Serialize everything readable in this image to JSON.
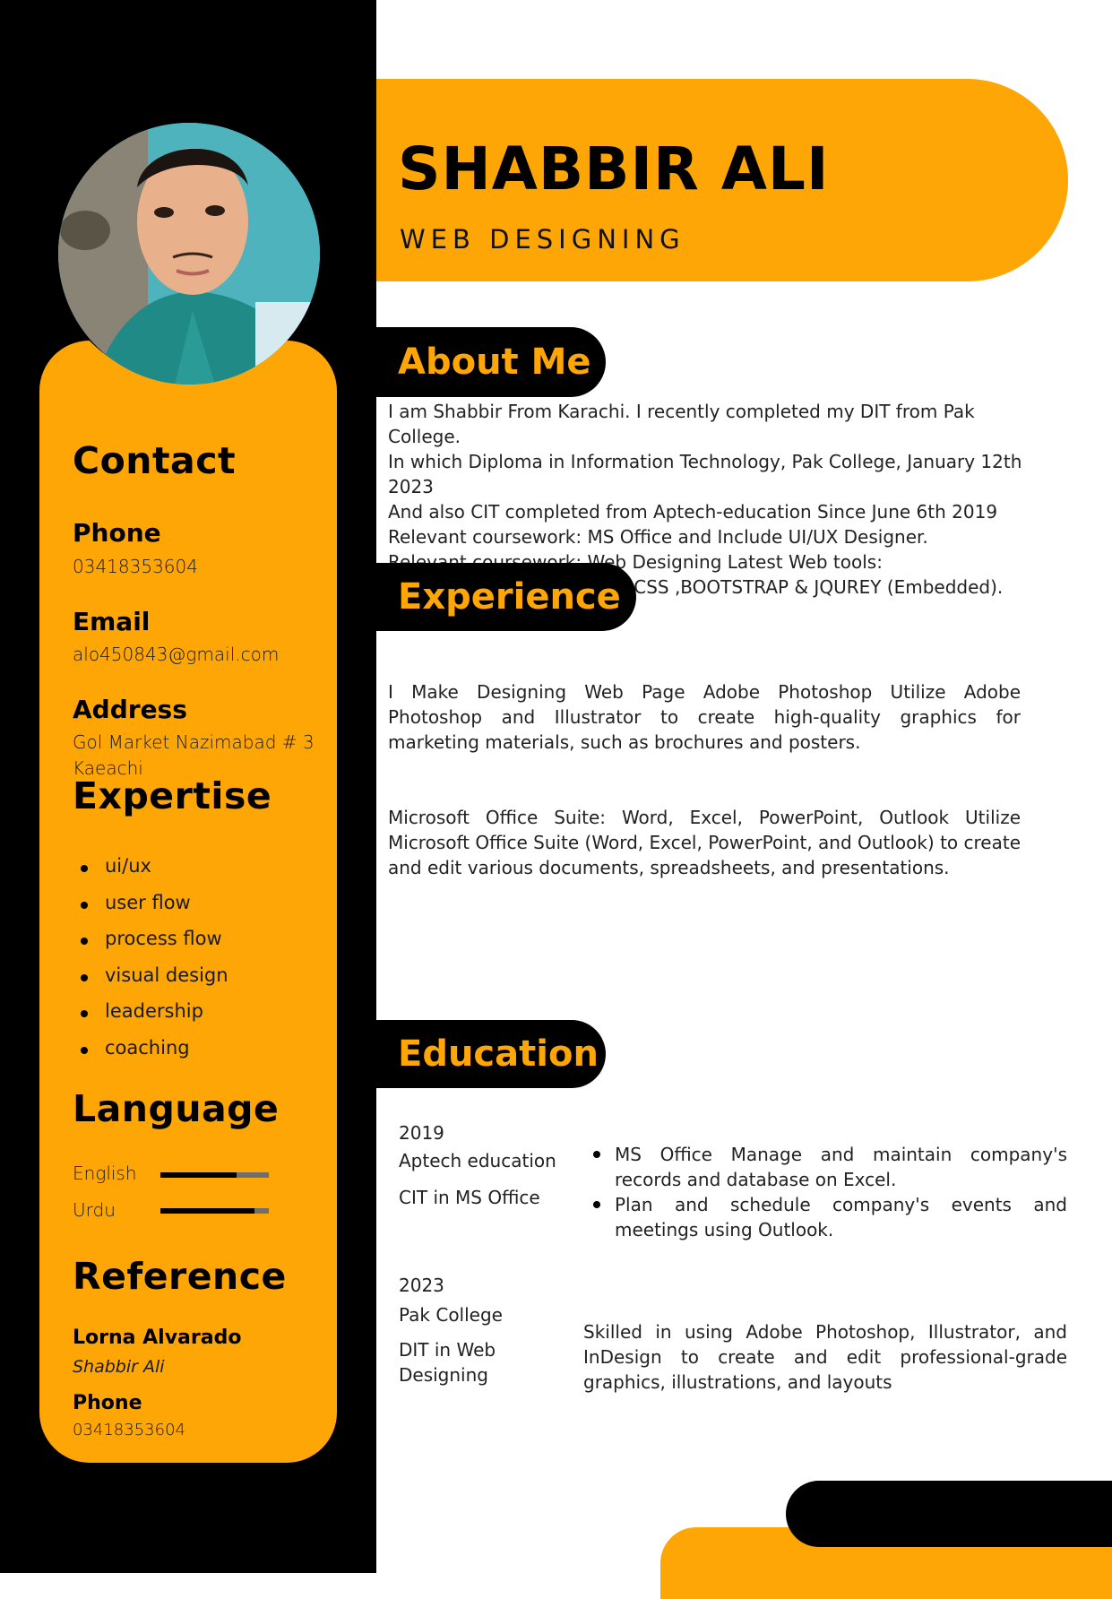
{
  "header": {
    "name": "SHABBIR ALI",
    "role": "WEB DESIGNING"
  },
  "sidebar": {
    "contact_heading": "Contact",
    "phone_label": "Phone",
    "phone_value": "03418353604",
    "email_label": "Email",
    "email_value": "alo450843@gmail.com",
    "address_label": "Address",
    "address_line1": "Gol Market Nazimabad # 3",
    "address_line2": "Kaeachi",
    "expertise_heading": "Expertise",
    "expertise": [
      "ui/ux",
      "user flow",
      "process flow",
      "visual design",
      "leadership",
      "coaching"
    ],
    "language_heading": "Language",
    "languages": [
      {
        "name": "English",
        "level": 0.7
      },
      {
        "name": "Urdu",
        "level": 0.87
      }
    ],
    "reference_heading": "Reference",
    "reference_name": "Lorna Alvarado",
    "reference_title": "Shabbir Ali",
    "reference_phone_label": "Phone",
    "reference_phone_value": "03418353604"
  },
  "about": {
    "heading": "About Me",
    "lines": [
      "I am Shabbir From Karachi. I recently completed my DIT from Pak College.",
      "In which Diploma in Information Technology, Pak College, January 12th 2023",
      "And also CIT  completed from Aptech-education Since June 6th 2019",
      "Relevant coursework: MS Office and Include UI/UX Designer.",
      "Relevant coursework: Web Designing Latest Web tools:",
      "Photoshop CC  ,SEO ,HTML ,CSS ,BOOTSTRAP & JQUREY (Embedded)."
    ]
  },
  "experience": {
    "heading": "Experience",
    "paragraph1": "I Make Designing Web Page  Adobe Photoshop Utilize Adobe Photoshop and Illustrator to create high-quality graphics for marketing materials, such as brochures and posters.",
    "paragraph2": "Microsoft Office Suite: Word, Excel, PowerPoint, Outlook Utilize Microsoft Office Suite (Word, Excel, PowerPoint, and Outlook) to create and edit various documents, spreadsheets, and presentations."
  },
  "education": {
    "heading": "Education",
    "entries": [
      {
        "year": "2019",
        "school": "Aptech education",
        "program": "CIT in MS Office",
        "bullets": [
          "MS Office Manage and maintain company's records and database on Excel.",
          "Plan and schedule company's events and meetings using Outlook."
        ]
      },
      {
        "year": "2023",
        "school": "Pak College",
        "program_line1": "DIT in Web",
        "program_line2": "Designing",
        "description": "Skilled in using Adobe Photoshop, Illustrator, and InDesign to create and edit professional-grade graphics, illustrations, and layouts"
      }
    ]
  },
  "colors": {
    "accent": "#fda605",
    "dark": "#000000",
    "photo_bg": "#3fa7b3"
  }
}
